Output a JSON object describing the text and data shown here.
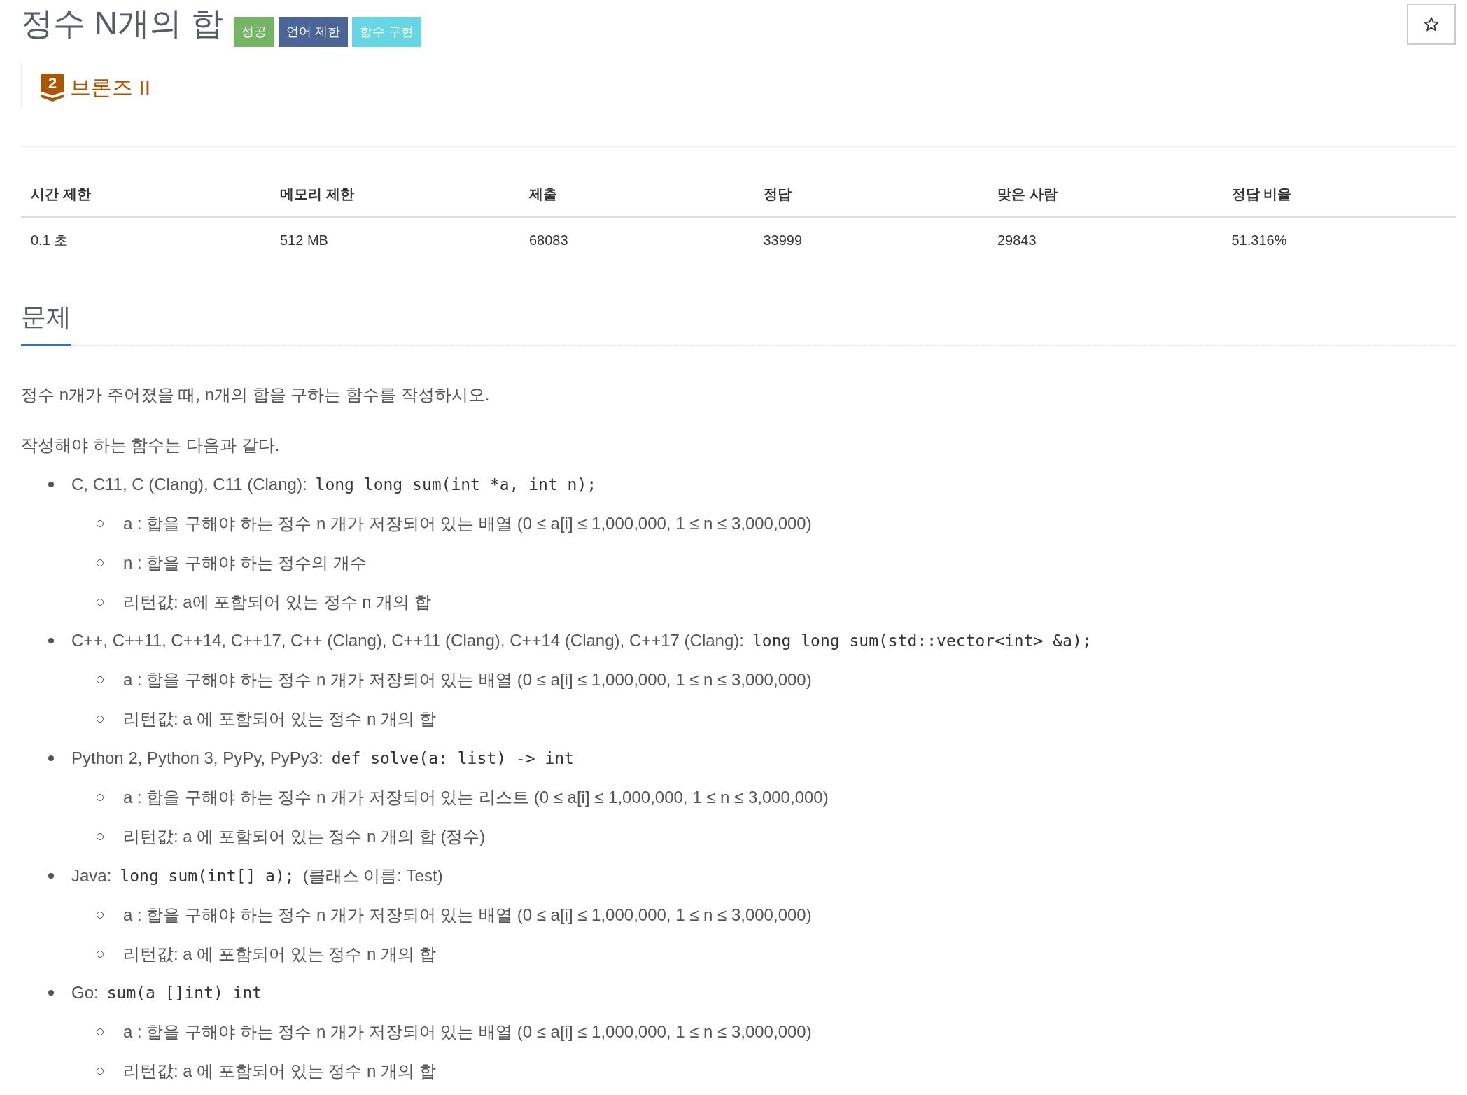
{
  "header": {
    "title": "정수 N개의 합",
    "labels": [
      {
        "text": "성공",
        "color": "#76b465"
      },
      {
        "text": "언어 제한",
        "color": "#4b6599"
      },
      {
        "text": "함수 구현",
        "color": "#66d5e4"
      }
    ],
    "tier": {
      "badge": "2",
      "text": "브론즈 II"
    }
  },
  "stats": {
    "columns": [
      "시간 제한",
      "메모리 제한",
      "제출",
      "정답",
      "맞은 사람",
      "정답 비율"
    ],
    "rows": [
      [
        "0.1 초",
        "512 MB",
        "68083",
        "33999",
        "29843",
        "51.316%"
      ]
    ]
  },
  "problem": {
    "heading": "문제",
    "paragraphs": [
      "정수 n개가 주어졌을 때, n개의 합을 구하는 함수를 작성하시오.",
      "작성해야 하는 함수는 다음과 같다."
    ],
    "items": [
      {
        "languages": "C, C11, C (Clang), C11 (Clang):",
        "signature": "long long sum(int *a, int n);",
        "children": [
          {
            "text": "a : 합을 구해야 하는 정수 n 개가 저장되어 있는 배열 (0 ≤ a[i] ≤ 1,000,000, 1 ≤ n ≤ 3,000,000)"
          },
          {
            "text": "n : 합을 구해야 하는 정수의 개수"
          },
          {
            "text": "리턴값: a에 포함되어 있는 정수 n 개의 합"
          }
        ]
      },
      {
        "languages": "C++, C++11, C++14, C++17, C++ (Clang), C++11 (Clang), C++14 (Clang), C++17 (Clang):",
        "signature": "long long sum(std::vector<int> &a);",
        "children": [
          {
            "text": "a : 합을 구해야 하는 정수 n 개가 저장되어 있는 배열 (0 ≤ a[i] ≤ 1,000,000, 1 ≤ n ≤ 3,000,000)"
          },
          {
            "text": "리턴값: a 에 포함되어 있는 정수 n 개의 합"
          }
        ]
      },
      {
        "languages": "Python 2, Python 3, PyPy, PyPy3:",
        "signature": "def solve(a: list) -> int",
        "children": [
          {
            "text": "a : 합을 구해야 하는 정수 n 개가 저장되어 있는 리스트 (0 ≤ a[i] ≤ 1,000,000, 1 ≤ n ≤ 3,000,000)"
          },
          {
            "text": "리턴값: a 에 포함되어 있는 정수 n 개의 합 (정수)"
          }
        ]
      },
      {
        "languages": "Java:",
        "signature": "long sum(int[] a);",
        "note": "(클래스 이름: Test)",
        "children": [
          {
            "text": "a : 합을 구해야 하는 정수 n 개가 저장되어 있는 배열 (0 ≤ a[i] ≤ 1,000,000, 1 ≤ n ≤ 3,000,000)"
          },
          {
            "text": "리턴값: a 에 포함되어 있는 정수 n 개의 합"
          }
        ]
      },
      {
        "languages": "Go:",
        "signature": "sum(a []int) int",
        "children": [
          {
            "text": "a : 합을 구해야 하는 정수 n 개가 저장되어 있는 배열 (0 ≤ a[i] ≤ 1,000,000, 1 ≤ n ≤ 3,000,000)"
          },
          {
            "text": "리턴값: a 에 포함되어 있는 정수 n 개의 합"
          }
        ]
      }
    ]
  }
}
